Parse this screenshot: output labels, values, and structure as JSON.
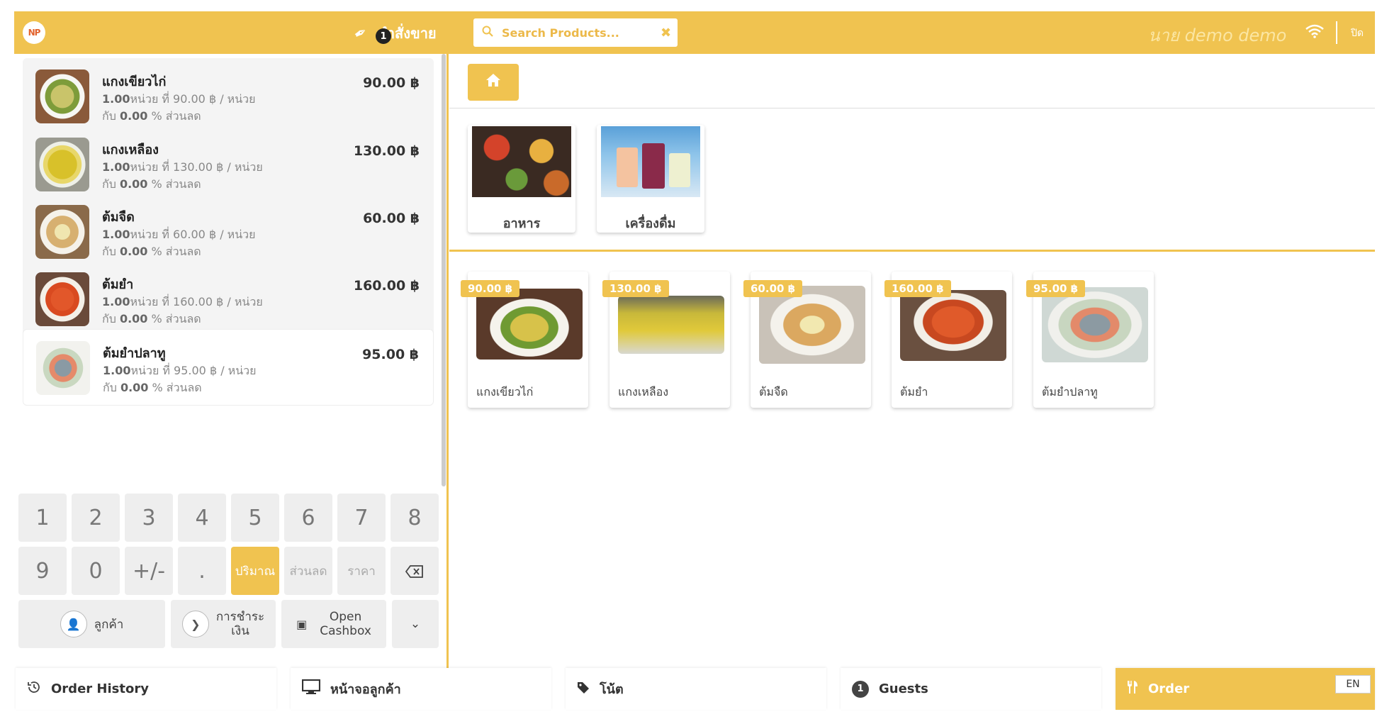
{
  "header": {
    "orders_label": "คำสั่งขาย",
    "orders_count": "1",
    "search_placeholder": "Search Products...",
    "user_name": "นาย demo demo",
    "close_label": "ปิด",
    "logo_text": "NP"
  },
  "order_lines": [
    {
      "name": "แกงเขียวไก่",
      "qty": "1.00",
      "detail_rest": "หน่วย ที่ 90.00 ฿ / หน่วย",
      "disc_prefix": "กับ ",
      "disc": "0.00",
      "disc_suffix": " % ส่วนลด",
      "price": "90.00 ฿"
    },
    {
      "name": "แกงเหลือง",
      "qty": "1.00",
      "detail_rest": "หน่วย ที่ 130.00 ฿ / หน่วย",
      "disc_prefix": "กับ ",
      "disc": "0.00",
      "disc_suffix": " % ส่วนลด",
      "price": "130.00 ฿"
    },
    {
      "name": "ต้มจืด",
      "qty": "1.00",
      "detail_rest": "หน่วย ที่ 60.00 ฿ / หน่วย",
      "disc_prefix": "กับ ",
      "disc": "0.00",
      "disc_suffix": " % ส่วนลด",
      "price": "60.00 ฿"
    },
    {
      "name": "ต้มยำ",
      "qty": "1.00",
      "detail_rest": "หน่วย ที่ 160.00 ฿ / หน่วย",
      "disc_prefix": "กับ ",
      "disc": "0.00",
      "disc_suffix": " % ส่วนลด",
      "price": "160.00 ฿"
    },
    {
      "name": "ต้มยำปลาทู",
      "qty": "1.00",
      "detail_rest": "หน่วย ที่ 95.00 ฿ / หน่วย",
      "disc_prefix": "กับ ",
      "disc": "0.00",
      "disc_suffix": " % ส่วนลด",
      "price": "95.00 ฿"
    }
  ],
  "numpad": {
    "row1": [
      "1",
      "2",
      "3",
      "4",
      "5",
      "6",
      "7",
      "8"
    ],
    "row2": [
      "9",
      "0",
      "+/-",
      "."
    ],
    "mode_qty": "ปริมาณ",
    "mode_disc": "ส่วนลด",
    "mode_price": "ราคา"
  },
  "actions": {
    "customer": "ลูกค้า",
    "payment_line1": "การชำระ",
    "payment_line2": "เงิน",
    "cashbox_line1": "Open",
    "cashbox_line2": "Cashbox"
  },
  "categories": [
    {
      "label": "อาหาร"
    },
    {
      "label": "เครื่องดื่ม"
    }
  ],
  "products": [
    {
      "name": "แกงเขียวไก่",
      "price": "90.00 ฿"
    },
    {
      "name": "แกงเหลือง",
      "price": "130.00 ฿"
    },
    {
      "name": "ต้มจืด",
      "price": "60.00 ฿"
    },
    {
      "name": "ต้มยำ",
      "price": "160.00 ฿"
    },
    {
      "name": "ต้มยำปลาทู",
      "price": "95.00 ฿"
    }
  ],
  "bottom": {
    "order_history": "Order History",
    "customer_display": "หน้าจอลูกค้า",
    "note": "โน้ต",
    "guests_count": "1",
    "guests": "Guests",
    "order": "Order",
    "lang": "EN"
  },
  "colors": {
    "accent": "#f0c350"
  }
}
